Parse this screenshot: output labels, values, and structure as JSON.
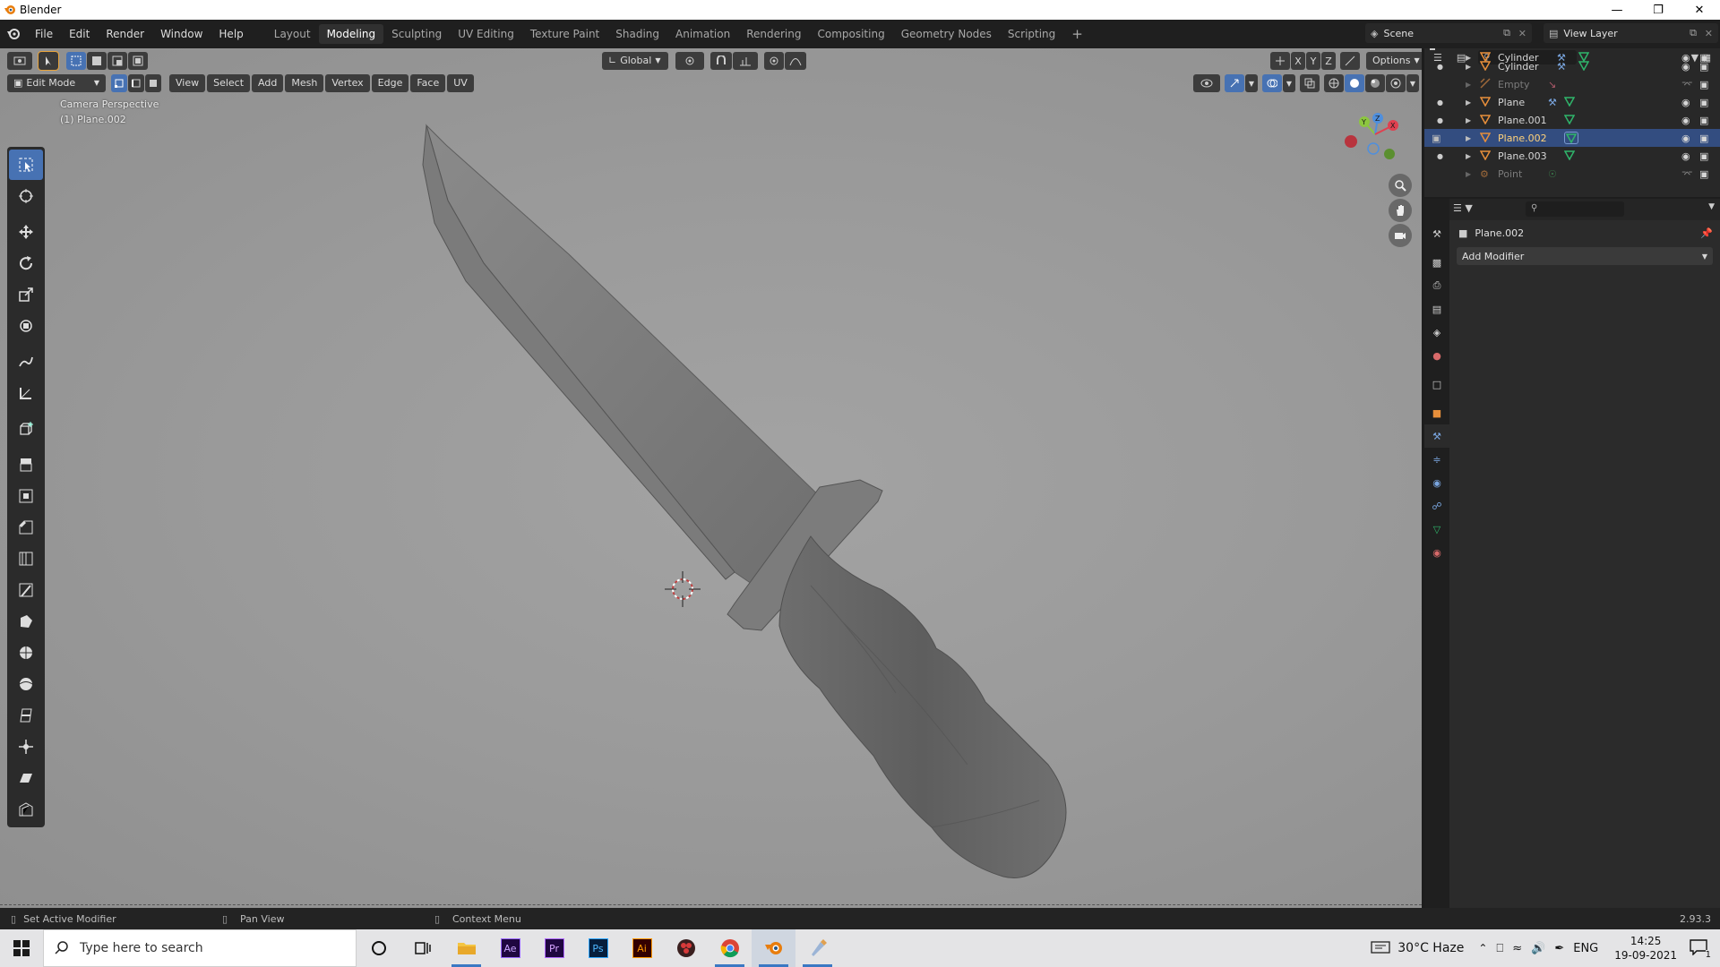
{
  "window": {
    "title": "Blender"
  },
  "menu": [
    "File",
    "Edit",
    "Render",
    "Window",
    "Help"
  ],
  "workspaces": [
    "Layout",
    "Modeling",
    "Sculpting",
    "UV Editing",
    "Texture Paint",
    "Shading",
    "Animation",
    "Rendering",
    "Compositing",
    "Geometry Nodes",
    "Scripting"
  ],
  "active_workspace": "Modeling",
  "scene": {
    "name": "Scene"
  },
  "view_layer": {
    "name": "View Layer"
  },
  "viewport": {
    "transform_orientation": "Global",
    "options_label": "Options",
    "mode": "Edit Mode",
    "header_menus": [
      "View",
      "Select",
      "Add",
      "Mesh",
      "Vertex",
      "Edge",
      "Face",
      "UV"
    ],
    "camera_label": "Camera Perspective",
    "object_label": "(1) Plane.002",
    "axis_labels": {
      "x": "X",
      "y": "Y",
      "z": "Z"
    }
  },
  "outliner": {
    "items": [
      {
        "name": "Cylinder",
        "dim": false,
        "selected": false
      },
      {
        "name": "Empty",
        "dim": true,
        "selected": false
      },
      {
        "name": "Plane",
        "dim": false,
        "selected": false
      },
      {
        "name": "Plane.001",
        "dim": false,
        "selected": false
      },
      {
        "name": "Plane.002",
        "dim": false,
        "selected": true
      },
      {
        "name": "Plane.003",
        "dim": false,
        "selected": false
      },
      {
        "name": "Point",
        "dim": true,
        "selected": false
      }
    ]
  },
  "properties": {
    "object_name": "Plane.002",
    "add_modifier_label": "Add Modifier"
  },
  "statusbar": {
    "left": "Set Active Modifier",
    "middle": "Pan View",
    "right": "Context Menu",
    "version": "2.93.3"
  },
  "taskbar": {
    "search_placeholder": "Type here to search",
    "weather": "30°C  Haze",
    "language": "ENG",
    "time": "14:25",
    "date": "19-09-2021",
    "notification_count": "1"
  },
  "colors": {
    "accent": "#4772b3",
    "selected_row": "#334d80",
    "object_icon": "#e88f3b",
    "mesh_icon": "#2fb56b"
  }
}
